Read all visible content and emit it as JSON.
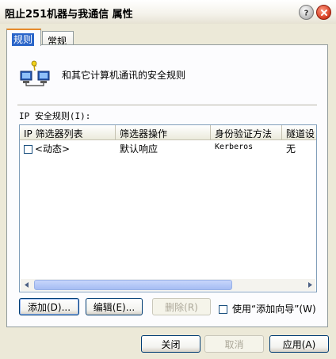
{
  "window": {
    "title": "阻止251机器与我通信 属性"
  },
  "tabs": [
    {
      "label": "规则",
      "active": true
    },
    {
      "label": "常规",
      "active": false
    }
  ],
  "header": {
    "text": "和其它计算机通讯的安全规则"
  },
  "rules": {
    "label": "IP 安全规则(I):",
    "columns": [
      "IP 筛选器列表",
      "筛选器操作",
      "身份验证方法",
      "隧道设"
    ],
    "rows": [
      {
        "checked": false,
        "filter_list": "<动态>",
        "filter_action": "默认响应",
        "auth": "Kerberos",
        "tunnel": "无"
      }
    ]
  },
  "buttons": {
    "add": "添加(D)...",
    "edit": "编辑(E)...",
    "remove": "删除(R)",
    "wizard_label": "使用“添加向导”(W)",
    "wizard_checked": false,
    "ok": "关闭",
    "cancel": "取消",
    "apply": "应用(A)"
  },
  "colors": {
    "accent": "#2a65c9",
    "tab_highlight": "#e68b2c",
    "button_border": "#003c74"
  }
}
